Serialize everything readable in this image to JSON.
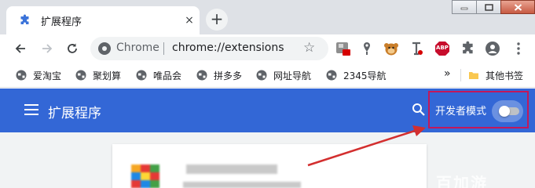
{
  "tab": {
    "title": "扩展程序",
    "close": "×"
  },
  "newtab": {
    "label": "+"
  },
  "omnibox": {
    "scheme": "Chrome",
    "url": "chrome://extensions",
    "star": "☆"
  },
  "extensions_toolbar": {
    "abp_label": "ABP"
  },
  "bookmarks": {
    "items": [
      {
        "label": "爱淘宝"
      },
      {
        "label": "聚划算"
      },
      {
        "label": "唯品会"
      },
      {
        "label": "拼多多"
      },
      {
        "label": "网址导航"
      },
      {
        "label": "2345导航"
      }
    ],
    "overflow": "»",
    "other": "其他书签"
  },
  "header": {
    "title": "扩展程序",
    "dev_mode_label": "开发者模式",
    "dev_mode_on": false
  },
  "colors": {
    "header_bg": "#3367d6",
    "highlight": "#c2185b",
    "arrow": "#d32f2f"
  },
  "watermark": "百加游"
}
